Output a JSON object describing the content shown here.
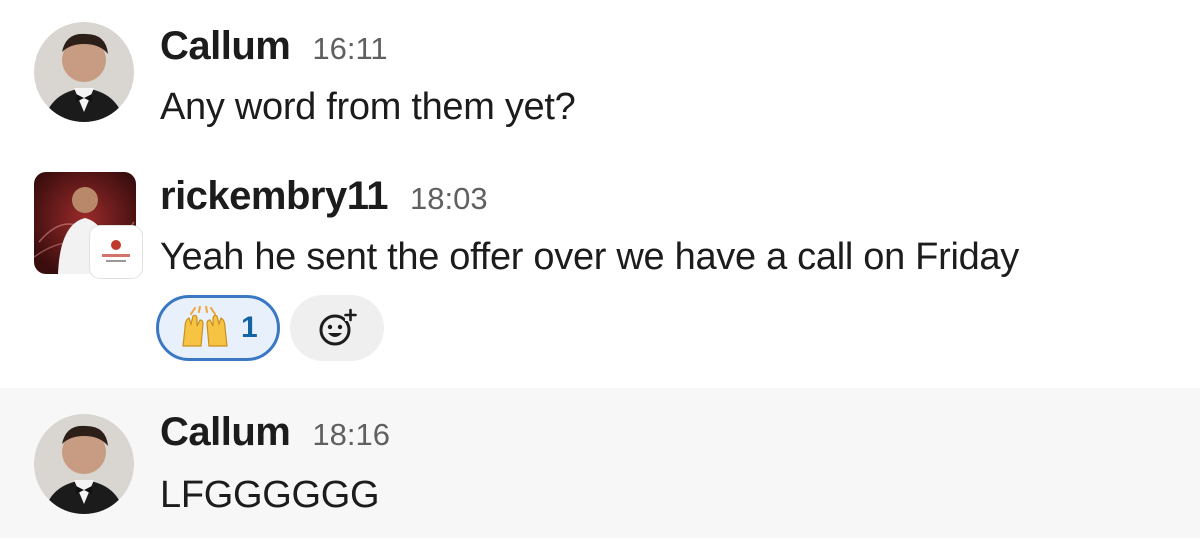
{
  "messages": [
    {
      "author": "Callum",
      "time": "16:11",
      "text": "Any word from them yet?"
    },
    {
      "author": "rickembry11",
      "time": "18:03",
      "text": "Yeah he sent the offer over we have a call on Friday",
      "reactions": [
        {
          "emoji": "raised-hands",
          "count": "1",
          "reacted_by_me": true
        }
      ]
    },
    {
      "author": "Callum",
      "time": "18:16",
      "text": "LFGGGGGG"
    }
  ],
  "icons": {
    "reaction": "raised-hands-emoji",
    "add_reaction": "add-reaction-icon"
  },
  "colors": {
    "reaction_border": "#3a78c4",
    "reaction_bg": "#e8f1fb",
    "reaction_count": "#1264a3",
    "hover_row_bg": "#f7f7f7",
    "timestamp": "#616061"
  }
}
